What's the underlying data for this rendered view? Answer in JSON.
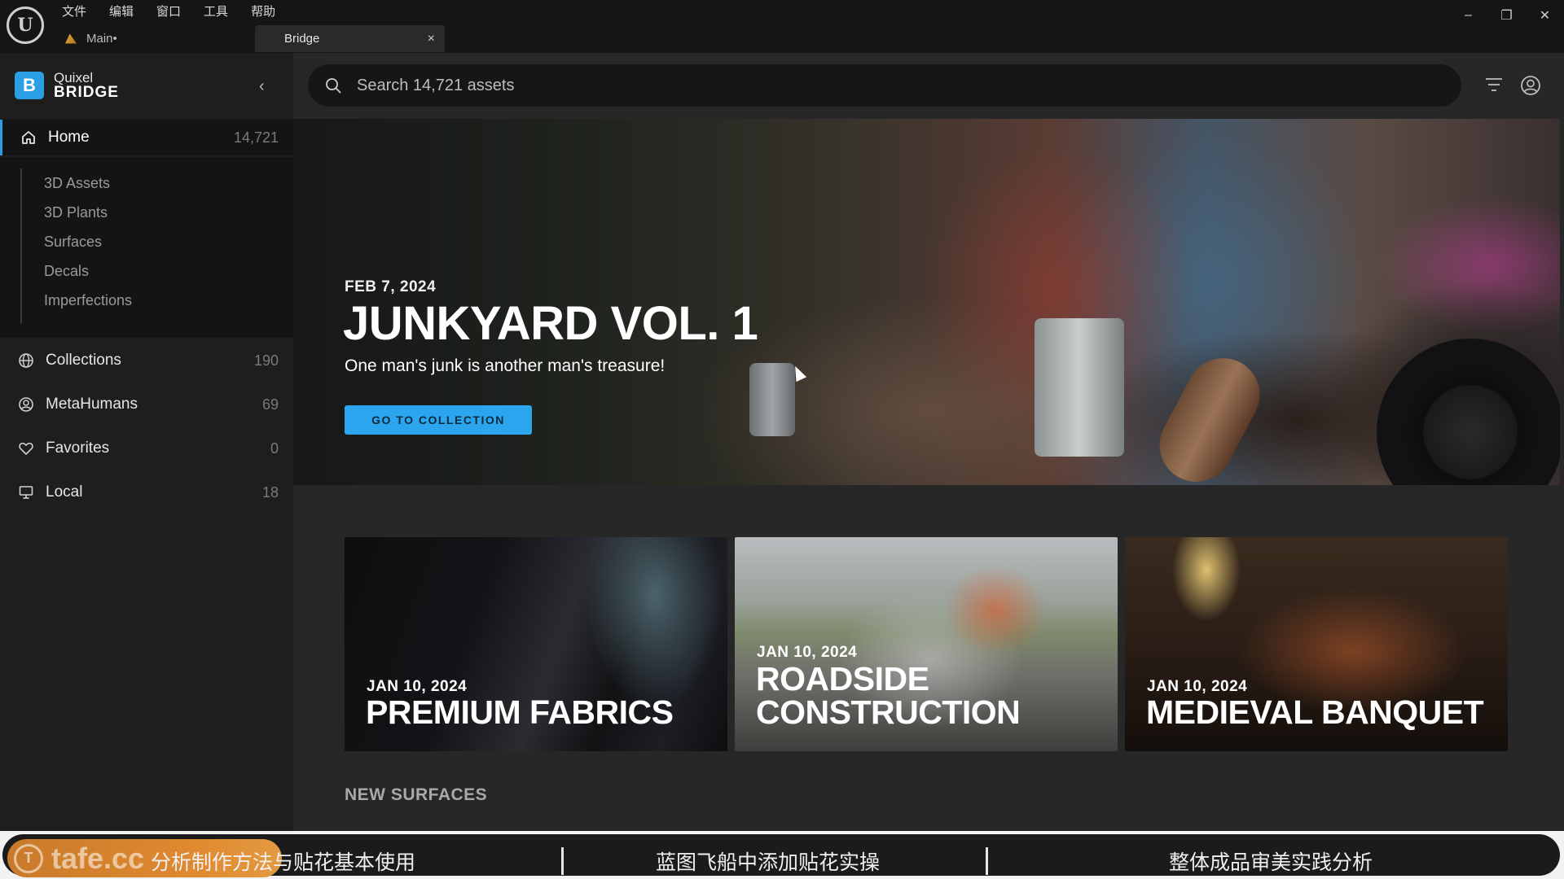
{
  "app": {
    "menu": [
      "文件",
      "编辑",
      "窗口",
      "工具",
      "帮助"
    ],
    "tabs": [
      {
        "label": "Main•"
      },
      {
        "label": "Bridge",
        "close": "×"
      }
    ],
    "window_controls": {
      "minimize": "–",
      "restore": "❐",
      "close": "✕"
    }
  },
  "sidebar": {
    "brand_top": "Quixel",
    "brand_bottom": "BRIDGE",
    "brand_badge": "B",
    "collapse": "‹",
    "home": {
      "label": "Home",
      "count": "14,721"
    },
    "sub_items": [
      "3D Assets",
      "3D Plants",
      "Surfaces",
      "Decals",
      "Imperfections"
    ],
    "items": [
      {
        "label": "Collections",
        "count": "190",
        "icon": "globe-icon"
      },
      {
        "label": "MetaHumans",
        "count": "69",
        "icon": "user-circle-icon"
      },
      {
        "label": "Favorites",
        "count": "0",
        "icon": "heart-icon"
      },
      {
        "label": "Local",
        "count": "18",
        "icon": "monitor-icon"
      }
    ]
  },
  "search": {
    "placeholder": "Search 14,721 assets"
  },
  "hero": {
    "date": "FEB 7, 2024",
    "title": "JUNKYARD VOL. 1",
    "subtitle": "One man's junk is another man's treasure!",
    "button": "GO TO COLLECTION"
  },
  "cards": [
    {
      "date": "JAN 10, 2024",
      "title_lines": [
        "PREMIUM FABRICS"
      ]
    },
    {
      "date": "JAN 10, 2024",
      "title_lines": [
        "ROADSIDE",
        "CONSTRUCTION"
      ]
    },
    {
      "date": "JAN 10, 2024",
      "title_lines": [
        "MEDIEVAL BANQUET"
      ]
    }
  ],
  "section_title": "NEW SURFACES",
  "banner": {
    "logo_text": "tafe.cc",
    "items": [
      "分析制作方法与贴花基本使用",
      "蓝图飞船中添加贴花实操",
      "整体成品审美实践分析"
    ]
  },
  "colors": {
    "accent": "#2aa5ee",
    "sidebar_bg": "#1e1e1e",
    "main_bg": "#272727"
  }
}
